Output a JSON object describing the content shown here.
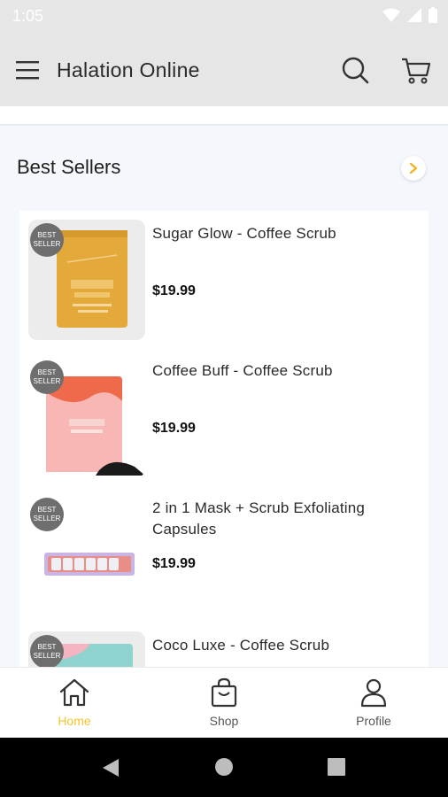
{
  "status_bar": {
    "time": "1:05"
  },
  "app_bar": {
    "title": "Halation Online"
  },
  "section": {
    "title": "Best Sellers"
  },
  "products": [
    {
      "name": "Sugar Glow - Coffee Scrub",
      "price": "$19.99",
      "badge_line1": "BEST",
      "badge_line2": "SELLER"
    },
    {
      "name": "Coffee Buff - Coffee Scrub",
      "price": "$19.99",
      "badge_line1": "BEST",
      "badge_line2": "SELLER"
    },
    {
      "name": "2 in 1 Mask + Scrub Exfoliating Capsules",
      "price": "$19.99",
      "badge_line1": "BEST",
      "badge_line2": "SELLER"
    },
    {
      "name": "Coco Luxe - Coffee Scrub",
      "price": "",
      "badge_line1": "BEST",
      "badge_line2": "SELLER"
    }
  ],
  "bottom_nav": [
    {
      "label": "Home",
      "icon": "home-icon",
      "active": true
    },
    {
      "label": "Shop",
      "icon": "bag-icon",
      "active": false
    },
    {
      "label": "Profile",
      "icon": "user-icon",
      "active": false
    }
  ],
  "colors": {
    "accent": "#f5c32b",
    "badge": "#6e6e6e",
    "appbar": "#e6e6e6"
  }
}
